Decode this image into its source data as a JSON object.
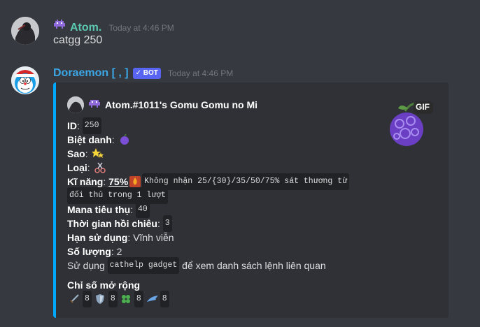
{
  "messages": [
    {
      "username": "Atom.",
      "username_color": "#5ac8b0",
      "timestamp": "Today at 4:46 PM",
      "content": "catgg 250"
    },
    {
      "username": "Doraemon [ , ]",
      "username_color": "#3ba7e6",
      "bot_tag": "✓ BOT",
      "timestamp": "Today at 4:46 PM"
    }
  ],
  "embed": {
    "accent_color": "#00a8fc",
    "author": "Atom.#1011's Gomu Gomu no Mi",
    "thumbnail_badge": "GIF",
    "fields": {
      "id_label": "ID",
      "id_value": "250",
      "nickname_label": "Biệt danh",
      "stars_label": "Sao",
      "type_label": "Loại",
      "skill_label": "Kĩ năng",
      "skill_percent": "75%",
      "skill_desc_1": "Không nhận 25/{30}/35/50/75% sát thương từ",
      "skill_desc_2": "đối thủ trong 1 lượt",
      "mana_label": "Mana tiêu thụ",
      "mana_value": "40",
      "cooldown_label": "Thời gian hồi chiêu",
      "cooldown_value": "3",
      "duration_label": "Hạn sử dụng",
      "duration_value": "Vĩnh viễn",
      "quantity_label": "Số lượng",
      "quantity_value": "2",
      "usage_prefix": "Sử dụng",
      "usage_command": "cathelp gadget",
      "usage_suffix": "để xem danh sách lệnh liên quan"
    },
    "stats_title": "Chỉ số mở rộng",
    "stats": [
      {
        "icon": "sword-icon",
        "value": "8"
      },
      {
        "icon": "shield-icon",
        "value": "8"
      },
      {
        "icon": "clover-icon",
        "value": "8"
      },
      {
        "icon": "wing-icon",
        "value": "8"
      }
    ]
  }
}
